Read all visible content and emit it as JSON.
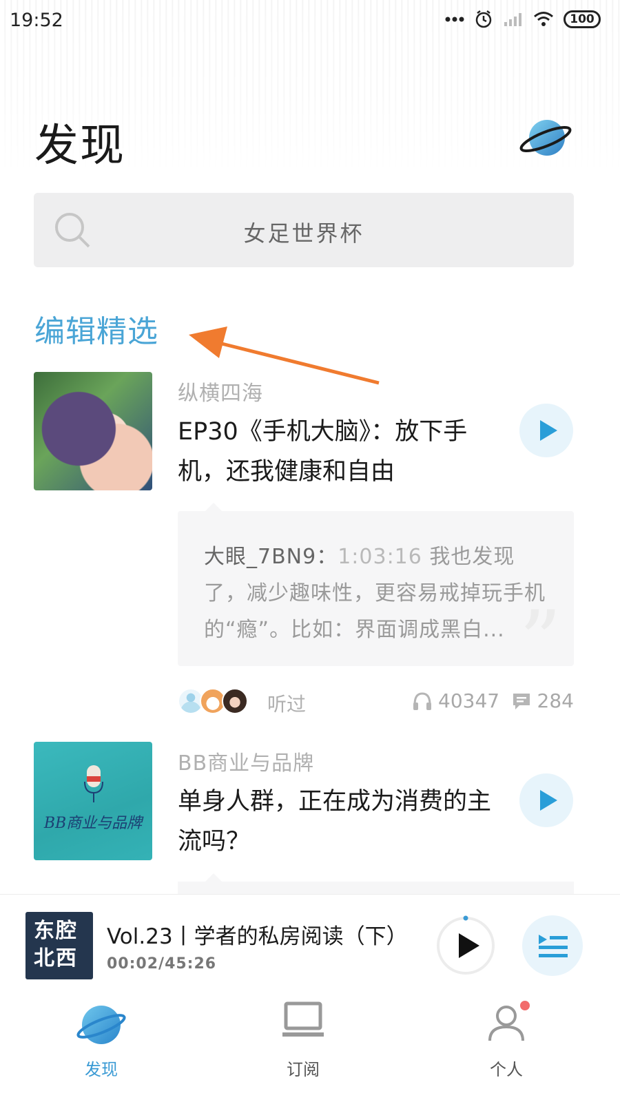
{
  "status_bar": {
    "time": "19:52",
    "battery": "100"
  },
  "header": {
    "title": "发现"
  },
  "search": {
    "placeholder": "女足世界杯"
  },
  "section": {
    "title": "编辑精选"
  },
  "feed": [
    {
      "channel": "纵横四海",
      "title": "EP30《手机大脑》：放下手机，还我健康和自由",
      "comment": {
        "user": "大眼_7BN9：",
        "timestamp": "1:03:16",
        "text": " 我也发现了，减少趣味性，更容易戒掉玩手机的“瘾”。比如：界面调成黑白..."
      },
      "heard_label": "听过",
      "listens": "40347",
      "comments": "284"
    },
    {
      "channel": "BB商业与品牌",
      "title": "单身人群，正在成为消费的主流吗？",
      "cover_text": "BB商业与品牌"
    }
  ],
  "player": {
    "cover_text_line1": "东腔",
    "cover_text_line2": "",
    "cover_text_line3": "",
    "cover_text_line4": "",
    "cover_lines": [
      "东腔",
      "北西"
    ],
    "title": "Vol.23丨学者的私房阅读（下）",
    "time": "00:02/45:26",
    "progress": 0.001
  },
  "nav": {
    "discover": "发现",
    "subscribe": "订阅",
    "me": "个人"
  },
  "colors": {
    "accent": "#3a9ad4",
    "play_bg": "#e7f4fb",
    "badge": "#f26b6b",
    "annotation_arrow": "#f07b2f"
  }
}
